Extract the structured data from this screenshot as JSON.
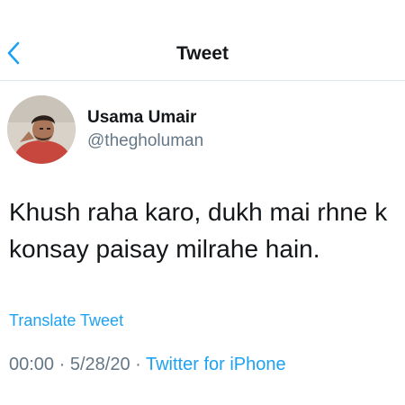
{
  "header": {
    "title": "Tweet",
    "back_icon": "chevron-left-icon"
  },
  "colors": {
    "accent": "#1da1f2",
    "text": "#14171a",
    "secondary": "#657786"
  },
  "user": {
    "name": "Usama Umair",
    "handle": "@thegholuman"
  },
  "tweet": {
    "lines": [
      "Khush raha karo, dukh mai rhne k",
      "konsay paisay milrahe hain."
    ],
    "translate_label": "Translate Tweet",
    "time": "00:00",
    "separator": " · ",
    "date": "5/28/20",
    "source": "Twitter for iPhone"
  }
}
